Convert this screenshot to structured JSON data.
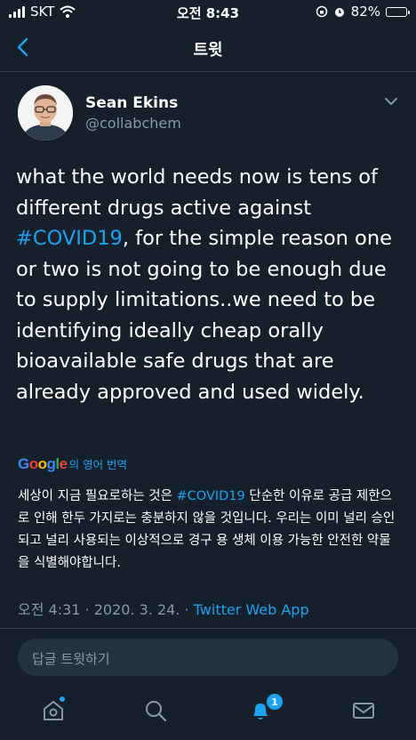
{
  "status_bar": {
    "carrier": "SKT",
    "time": "오전 8:43",
    "battery": "82%",
    "battery_level": 0.82
  },
  "nav": {
    "title": "트윗"
  },
  "tweet": {
    "author_name": "Sean Ekins",
    "author_handle": "@collabchem",
    "text_part1": "what the world needs now is tens of different drugs active against ",
    "hashtag": "#COVID19",
    "text_part2": ", for the simple reason one or two is not going to be enough due to supply limitations..we need to be identifying ideally cheap orally bioavailable safe drugs that are already approved and used widely.",
    "translate_logo": "Google",
    "translate_label": "의 영어 번역",
    "translation_part1": "세상이 지금 필요로하는 것은 ",
    "translation_hashtag": "#COVID19",
    "translation_part2": " 단순한 이유로 공급 제한으로 인해 한두 가지로는 충분하지 않을 것입니다. 우리는 이미 널리 승인되고 널리 사용되는 이상적으로 경구 용 생체 이용 가능한 안전한 약물을 식별해야합니다.",
    "timestamp": "오전 4:31 · 2020. 3. 24. · ",
    "source": "Twitter Web App"
  },
  "reply": {
    "placeholder": "답글 트윗하기"
  },
  "tab_bar": {
    "notification_count": "1"
  },
  "colors": {
    "background": "#15202b",
    "accent": "#1da1f2",
    "secondary_text": "#8899a6",
    "divider": "#38444d"
  }
}
